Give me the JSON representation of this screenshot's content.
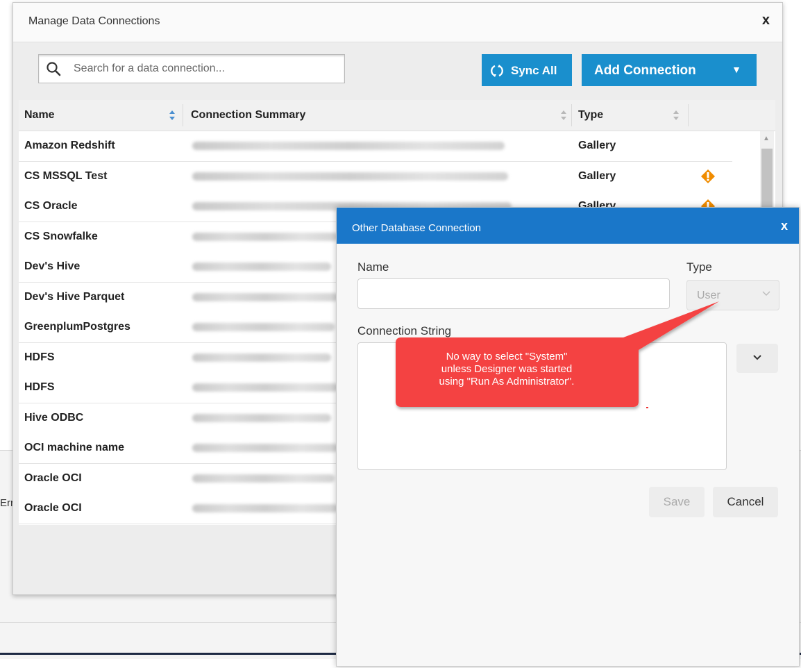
{
  "background": {
    "error_fragment": "Err"
  },
  "manage_dialog": {
    "title": "Manage Data Connections",
    "close_glyph": "x",
    "search_placeholder": "Search for a data connection...",
    "sync_label": "Sync All",
    "add_label": "Add Connection",
    "add_caret": "▼",
    "columns": [
      "Name",
      "Connection Summary",
      "Type"
    ],
    "rows": [
      {
        "name": "Amazon Redshift",
        "type": "Gallery",
        "warning": false
      },
      {
        "name": "CS MSSQL Test",
        "type": "Gallery",
        "warning": true
      },
      {
        "name": "CS Oracle",
        "type": "Gallery",
        "warning": true
      },
      {
        "name": "CS Snowfalke",
        "type": "",
        "warning": false
      },
      {
        "name": "Dev's Hive",
        "type": "",
        "warning": false
      },
      {
        "name": "Dev's Hive Parquet",
        "type": "",
        "warning": false
      },
      {
        "name": "GreenplumPostgres",
        "type": "",
        "warning": false
      },
      {
        "name": "HDFS",
        "type": "",
        "warning": false
      },
      {
        "name": "HDFS",
        "type": "",
        "warning": false
      },
      {
        "name": "Hive ODBC",
        "type": "",
        "warning": false
      },
      {
        "name": "OCI machine name",
        "type": "",
        "warning": false
      },
      {
        "name": "Oracle OCI",
        "type": "",
        "warning": false
      },
      {
        "name": "Oracle OCI",
        "type": "",
        "warning": false
      }
    ]
  },
  "other_dialog": {
    "title": "Other Database Connection",
    "close_glyph": "x",
    "name_label": "Name",
    "type_label": "Type",
    "type_value": "User",
    "connection_string_label": "Connection String",
    "save_label": "Save",
    "cancel_label": "Cancel"
  },
  "callout": {
    "lines": [
      "No way to select \"System\"",
      "unless Designer was started",
      "using \"Run As Administrator\"."
    ]
  },
  "colors": {
    "accent": "#1a8fcd",
    "dialog_header": "#1a77c9",
    "warning": "#f08c00",
    "callout": "#f44242"
  }
}
